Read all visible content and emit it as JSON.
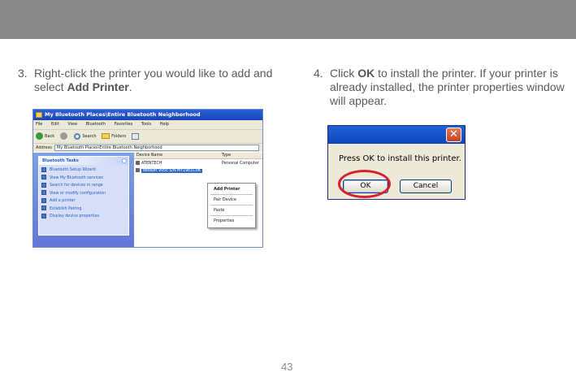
{
  "steps": [
    {
      "number": "3.",
      "text_before": "Right-click the printer you would like to add and select ",
      "bold": "Add Printer",
      "text_after": "."
    },
    {
      "number": "4.",
      "text_before": "Click ",
      "bold": "OK",
      "text_after": " to install the printer. If your printer is already installed, the printer properties window will appear."
    }
  ],
  "explorer": {
    "title": "My Bluetooth Places\\Entire Bluetooth Neighborhood",
    "menu": [
      "File",
      "Edit",
      "View",
      "Bluetooth",
      "Favorites",
      "Tools",
      "Help"
    ],
    "toolbar": {
      "back": "Back",
      "search": "Search",
      "folders": "Folders"
    },
    "address_label": "Address",
    "address_value": "My Bluetooth Places\\Entire Bluetooth Neighborhood",
    "tasks_header": "Bluetooth Tasks",
    "tasks": [
      "Bluetooth Setup Wizard",
      "View My Bluetooth services",
      "Search for devices in range",
      "View or modify configuration",
      "Add a printer",
      "Establish Pairing",
      "Display device properties"
    ],
    "columns": {
      "name": "Device Name",
      "type": "Type"
    },
    "devices": [
      {
        "name": "ATENTECH",
        "type": "Personal Computer"
      },
      {
        "name": "deskjet 995c S/N MY19E1C0K",
        "type": ""
      }
    ],
    "context_menu": [
      "Add Printer",
      "Pair Device",
      "Paste",
      "Properties"
    ]
  },
  "dialog": {
    "close_glyph": "✕",
    "message": "Press OK to install this printer.",
    "ok_label": "OK",
    "cancel_label": "Cancel"
  },
  "page_number": "43",
  "colors": {
    "highlight": "#d7202b",
    "banner": "#8a8a8a"
  }
}
